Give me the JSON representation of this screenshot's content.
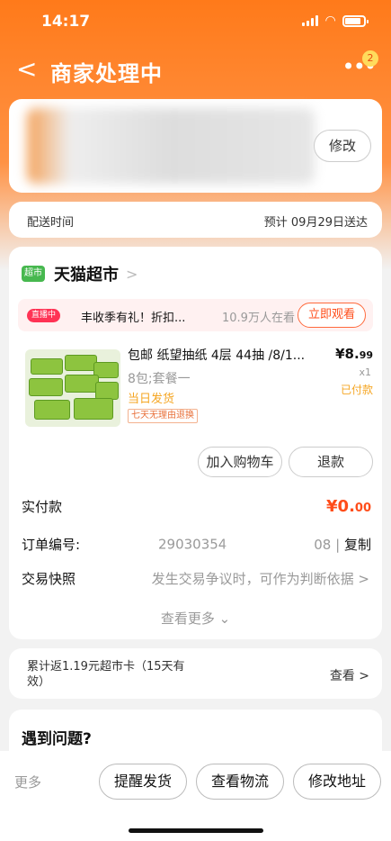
{
  "status_bar": {
    "time": "14:17 ⁽⁾",
    "time_text": "14:17"
  },
  "nav": {
    "back": "<",
    "title": "商家处理中",
    "more": "•••",
    "badge": "2"
  },
  "address": {
    "edit_label": "修改"
  },
  "delivery": {
    "label": "配送时间",
    "value": "预计 09月29日送达"
  },
  "shop": {
    "icon_text": "超市",
    "name": "天猫超市",
    "arrow": ">"
  },
  "live": {
    "tag": "直播中",
    "text": "丰收季有礼！折扣...",
    "viewers": "10.9万人在看",
    "button": "立即观看"
  },
  "product": {
    "title": "包邮 纸望抽纸 4层 44抽 /8/1...",
    "spec": "8包;套餐一",
    "shipping": "当日发货",
    "guarantee": "七天无理由退换",
    "price_main": "¥8.",
    "price_decimal": "99",
    "qty": "x1",
    "status": "已付款"
  },
  "actions": {
    "add_to_cart": "加入购物车",
    "refund": "退款"
  },
  "order": {
    "paid_label": "实付款",
    "paid_main": "¥0.",
    "paid_decimal": "00",
    "number_label": "订单编号:",
    "number_prefix": "29030354",
    "number_suffix": "08",
    "copy_separator": "|",
    "copy_label": "复制",
    "snapshot_label": "交易快照",
    "snapshot_hint": "发生交易争议时，可作为判断依据 >",
    "see_more": "查看更多 ⌄"
  },
  "coupon": {
    "text": "累计返1.19元超市卡（15天有效）",
    "link": "查看 >"
  },
  "problem": {
    "title": "遇到问题?"
  },
  "bottom_bar": {
    "more": "更多",
    "remind": "提醒发货",
    "logistics": "查看物流",
    "change_address": "修改地址"
  },
  "colors": {
    "accent_orange": "#ff7a1a",
    "price_red": "#ff4d1a",
    "shop_green": "#47b84f"
  }
}
